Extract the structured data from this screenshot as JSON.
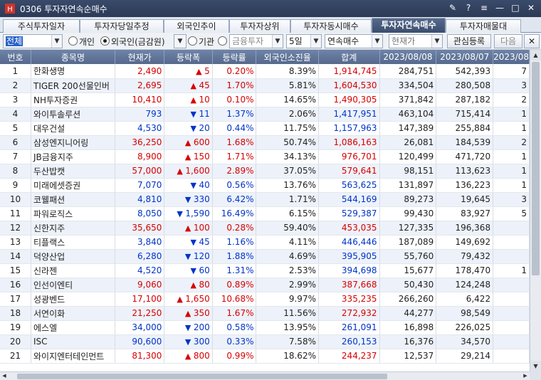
{
  "window": {
    "title": "0306 투자자연속순매수"
  },
  "tabs": [
    {
      "label": "주식투자일자"
    },
    {
      "label": "투자자당일추정"
    },
    {
      "label": "외국인추이"
    },
    {
      "label": "투자자상위"
    },
    {
      "label": "투자자동시매수"
    },
    {
      "label": "투자자연속매수"
    },
    {
      "label": "투자자매물대"
    }
  ],
  "active_tab": "투자자연속매수",
  "toolbar": {
    "market": "전체",
    "investor_options": [
      "개인",
      "외국인(금감원)",
      "기관",
      "금융투자"
    ],
    "investor_selected": "외국인(금감원)",
    "period": "5일",
    "mode": "연속매수",
    "price_type": "현재가",
    "watchlist_label": "관심등록",
    "next_label": "다음"
  },
  "columns": [
    "번호",
    "종목명",
    "현재가",
    "등락폭",
    "등락률",
    "외국인소진율",
    "합계",
    "2023/08/08",
    "2023/08/07",
    "2023/08"
  ],
  "rows": [
    {
      "no": "1",
      "name": "한화생명",
      "price": "2,490",
      "dir": "up",
      "chg": "5",
      "rate": "0.20%",
      "exh": "8.39%",
      "sum": "1,914,745",
      "d1": "284,751",
      "d2": "542,393",
      "d3": "7"
    },
    {
      "no": "2",
      "name": "TIGER 200선물인버",
      "price": "2,695",
      "dir": "up",
      "chg": "45",
      "rate": "1.70%",
      "exh": "5.81%",
      "sum": "1,604,530",
      "d1": "334,504",
      "d2": "280,508",
      "d3": "3"
    },
    {
      "no": "3",
      "name": "NH투자증권",
      "price": "10,410",
      "dir": "up",
      "chg": "10",
      "rate": "0.10%",
      "exh": "14.65%",
      "sum": "1,490,305",
      "d1": "371,842",
      "d2": "287,182",
      "d3": "2"
    },
    {
      "no": "4",
      "name": "와이투솔루션",
      "price": "793",
      "dir": "dn",
      "chg": "11",
      "rate": "1.37%",
      "exh": "2.06%",
      "sum": "1,417,951",
      "d1": "463,104",
      "d2": "715,414",
      "d3": "1"
    },
    {
      "no": "5",
      "name": "대우건설",
      "price": "4,530",
      "dir": "dn",
      "chg": "20",
      "rate": "0.44%",
      "exh": "11.75%",
      "sum": "1,157,963",
      "d1": "147,389",
      "d2": "255,884",
      "d3": "1"
    },
    {
      "no": "6",
      "name": "삼성엔지니어링",
      "price": "36,250",
      "dir": "up",
      "chg": "600",
      "rate": "1.68%",
      "exh": "50.74%",
      "sum": "1,086,163",
      "d1": "26,081",
      "d2": "184,539",
      "d3": "2"
    },
    {
      "no": "7",
      "name": "JB금융지주",
      "price": "8,900",
      "dir": "up",
      "chg": "150",
      "rate": "1.71%",
      "exh": "34.13%",
      "sum": "976,701",
      "d1": "120,499",
      "d2": "471,720",
      "d3": "1"
    },
    {
      "no": "8",
      "name": "두산밥캣",
      "price": "57,000",
      "dir": "up",
      "chg": "1,600",
      "rate": "2.89%",
      "exh": "37.05%",
      "sum": "579,641",
      "d1": "98,151",
      "d2": "113,623",
      "d3": "1"
    },
    {
      "no": "9",
      "name": "미래에셋증권",
      "price": "7,070",
      "dir": "dn",
      "chg": "40",
      "rate": "0.56%",
      "exh": "13.76%",
      "sum": "563,625",
      "d1": "131,897",
      "d2": "136,223",
      "d3": "1"
    },
    {
      "no": "10",
      "name": "코웰패션",
      "price": "4,810",
      "dir": "dn",
      "chg": "330",
      "rate": "6.42%",
      "exh": "1.71%",
      "sum": "544,169",
      "d1": "89,273",
      "d2": "19,645",
      "d3": "3"
    },
    {
      "no": "11",
      "name": "파워로직스",
      "price": "8,050",
      "dir": "dn",
      "chg": "1,590",
      "rate": "16.49%",
      "exh": "6.15%",
      "sum": "529,387",
      "d1": "99,430",
      "d2": "83,927",
      "d3": "5"
    },
    {
      "no": "12",
      "name": "신한지주",
      "price": "35,650",
      "dir": "up",
      "chg": "100",
      "rate": "0.28%",
      "exh": "59.40%",
      "sum": "453,035",
      "d1": "127,335",
      "d2": "196,368",
      "d3": ""
    },
    {
      "no": "13",
      "name": "티플랙스",
      "price": "3,840",
      "dir": "dn",
      "chg": "45",
      "rate": "1.16%",
      "exh": "4.11%",
      "sum": "446,446",
      "d1": "187,089",
      "d2": "149,692",
      "d3": ""
    },
    {
      "no": "14",
      "name": "덕양산업",
      "price": "6,280",
      "dir": "dn",
      "chg": "120",
      "rate": "1.88%",
      "exh": "4.69%",
      "sum": "395,905",
      "d1": "55,760",
      "d2": "79,432",
      "d3": ""
    },
    {
      "no": "15",
      "name": "신라젠",
      "price": "4,520",
      "dir": "dn",
      "chg": "60",
      "rate": "1.31%",
      "exh": "2.53%",
      "sum": "394,698",
      "d1": "15,677",
      "d2": "178,470",
      "d3": "1"
    },
    {
      "no": "16",
      "name": "인선이엔티",
      "price": "9,060",
      "dir": "up",
      "chg": "80",
      "rate": "0.89%",
      "exh": "2.99%",
      "sum": "387,668",
      "d1": "50,430",
      "d2": "124,248",
      "d3": ""
    },
    {
      "no": "17",
      "name": "성광벤드",
      "price": "17,100",
      "dir": "up",
      "chg": "1,650",
      "rate": "10.68%",
      "exh": "9.97%",
      "sum": "335,235",
      "d1": "266,260",
      "d2": "6,422",
      "d3": ""
    },
    {
      "no": "18",
      "name": "서연이화",
      "price": "21,250",
      "dir": "up",
      "chg": "350",
      "rate": "1.67%",
      "exh": "11.56%",
      "sum": "272,932",
      "d1": "44,277",
      "d2": "98,549",
      "d3": ""
    },
    {
      "no": "19",
      "name": "에스엘",
      "price": "34,000",
      "dir": "dn",
      "chg": "200",
      "rate": "0.58%",
      "exh": "13.95%",
      "sum": "261,091",
      "d1": "16,898",
      "d2": "226,025",
      "d3": ""
    },
    {
      "no": "20",
      "name": "ISC",
      "price": "90,600",
      "dir": "dn",
      "chg": "300",
      "rate": "0.33%",
      "exh": "7.58%",
      "sum": "260,153",
      "d1": "16,376",
      "d2": "34,570",
      "d3": ""
    },
    {
      "no": "21",
      "name": "와이지엔터테인먼트",
      "price": "81,300",
      "dir": "up",
      "chg": "800",
      "rate": "0.99%",
      "exh": "18.62%",
      "sum": "244,237",
      "d1": "12,537",
      "d2": "29,214",
      "d3": ""
    }
  ]
}
